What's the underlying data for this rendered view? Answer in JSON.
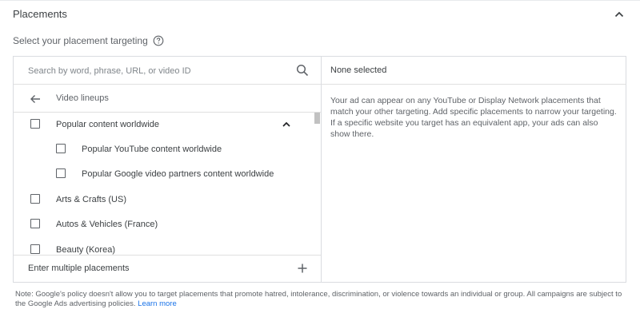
{
  "header": {
    "title": "Placements",
    "subtitle": "Select your placement targeting"
  },
  "search": {
    "placeholder": "Search by word, phrase, URL, or video ID"
  },
  "nav": {
    "label": "Video lineups"
  },
  "list": {
    "items": [
      {
        "label": "Popular content worldwide",
        "checked": false,
        "expanded": true
      },
      {
        "label": "Popular YouTube content worldwide",
        "checked": false
      },
      {
        "label": "Popular Google video partners content worldwide",
        "checked": false
      },
      {
        "label": "Arts & Crafts (US)",
        "checked": false
      },
      {
        "label": "Autos & Vehicles (France)",
        "checked": false
      },
      {
        "label": "Beauty (Korea)",
        "checked": false
      }
    ]
  },
  "bottom": {
    "label": "Enter multiple placements"
  },
  "right": {
    "header": "None selected",
    "description": "Your ad can appear on any YouTube or Display Network placements that match your other targeting. Add specific placements to narrow your targeting. If a specific website you target has an equivalent app, your ads can also show there."
  },
  "note": {
    "text": "Note: Google's policy doesn't allow you to target placements that promote hatred, intolerance, discrimination, or violence towards an individual or group. All campaigns are subject to the Google Ads advertising policies.",
    "link": "Learn more"
  },
  "colors": {
    "text": "#3c4043",
    "secondary": "#5f6368",
    "border": "#dadce0",
    "link": "#1a73e8"
  },
  "icons": [
    "chevron-up-icon",
    "help-icon",
    "search-icon",
    "arrow-back-icon",
    "plus-icon"
  ]
}
